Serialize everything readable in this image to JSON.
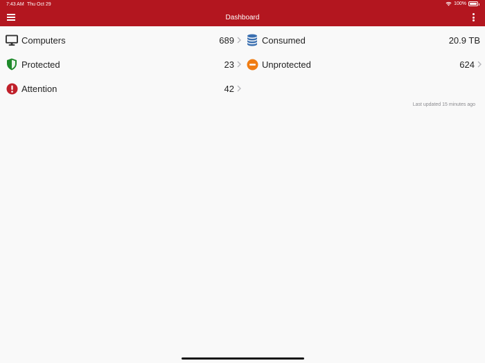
{
  "status_bar": {
    "time": "7:43 AM",
    "date": "Thu Oct 29",
    "battery": "100%"
  },
  "header": {
    "title": "Dashboard",
    "menu_icon": "hamburger-icon",
    "more_icon": "more-vertical-icon",
    "color": "#b3161f"
  },
  "stats": {
    "computers": {
      "label": "Computers",
      "value": "689",
      "icon": "monitor-icon"
    },
    "protected": {
      "label": "Protected",
      "value": "23",
      "icon": "shield-icon",
      "color": "#1f8a2b"
    },
    "attention": {
      "label": "Attention",
      "value": "42",
      "icon": "alert-icon",
      "color": "#c0202a"
    },
    "consumed": {
      "label": "Consumed",
      "value": "20.9 TB",
      "icon": "database-icon",
      "color": "#3a6fb0"
    },
    "unprotected": {
      "label": "Unprotected",
      "value": "624",
      "icon": "minus-circle-icon",
      "color": "#f07c12"
    }
  },
  "footer": {
    "last_updated": "Last updated 15 minutes ago"
  }
}
